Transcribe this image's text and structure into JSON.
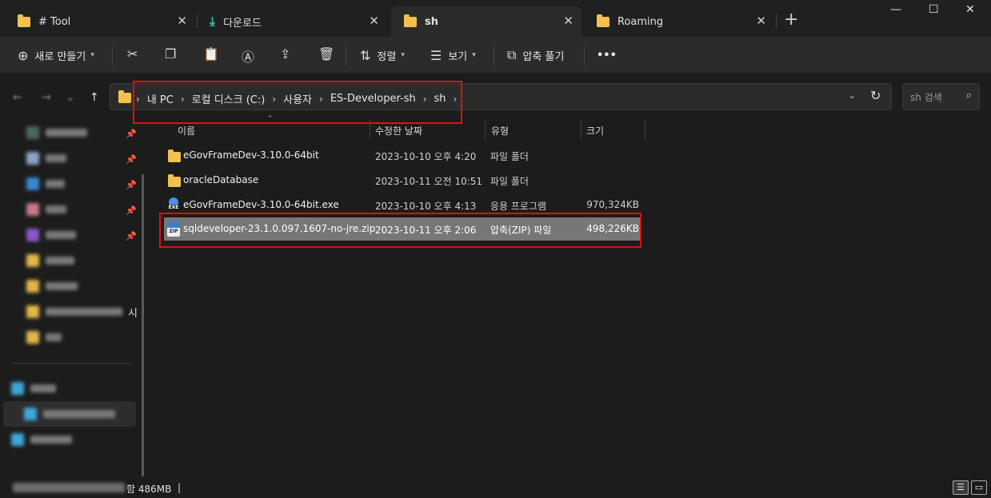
{
  "tabs": [
    {
      "label": "# Tool",
      "icon": "folder-icon"
    },
    {
      "label": "다운로드",
      "icon": "download-icon"
    },
    {
      "label": "sh",
      "icon": "folder-icon",
      "active": true
    },
    {
      "label": "Roaming",
      "icon": "folder-icon"
    }
  ],
  "tab_close_glyph": "✕",
  "new_tab_glyph": "+",
  "window_controls": {
    "minimize": "—",
    "maximize": "☐",
    "close": "✕"
  },
  "toolbar": {
    "new_label": "새로 만들기",
    "sort_label": "정렬",
    "view_label": "보기",
    "extract_label": "압축 풀기",
    "more_label": "•••"
  },
  "address": {
    "segments": [
      "내 PC",
      "로컬 디스크 (C:)",
      "사용자",
      "ES-Developer-sh",
      "sh"
    ],
    "separator": "›"
  },
  "search": {
    "placeholder": "sh 검색"
  },
  "columns": {
    "name": "이름",
    "date": "수정한 날짜",
    "type": "유형",
    "size": "크기"
  },
  "files": [
    {
      "name": "eGovFrameDev-3.10.0-64bit",
      "date": "2023-10-10 오후 4:20",
      "type": "파일 폴더",
      "size": "",
      "icon": "folder-icon"
    },
    {
      "name": "oracleDatabase",
      "date": "2023-10-11 오전 10:51",
      "type": "파일 폴더",
      "size": "",
      "icon": "folder-icon"
    },
    {
      "name": "eGovFrameDev-3.10.0-64bit.exe",
      "date": "2023-10-10 오후 4:13",
      "type": "응용 프로그램",
      "size": "970,324KB",
      "icon": "exe-icon"
    },
    {
      "name": "sqldeveloper-23.1.0.097.1607-no-jre.zip",
      "date": "2023-10-11 오후 2:06",
      "type": "압축(ZIP) 파일",
      "size": "498,226KB",
      "icon": "zip-icon",
      "selected": true
    }
  ],
  "icon_labels": {
    "exe": "EXE",
    "zip": "ZIP"
  },
  "sidebar": {
    "partial_text": "시"
  },
  "status": {
    "text": "함 486MB",
    "cursor": "|"
  },
  "colors": {
    "accent_highlight": "#e01010",
    "selection": "#777777",
    "folder": "#f2c14e"
  }
}
